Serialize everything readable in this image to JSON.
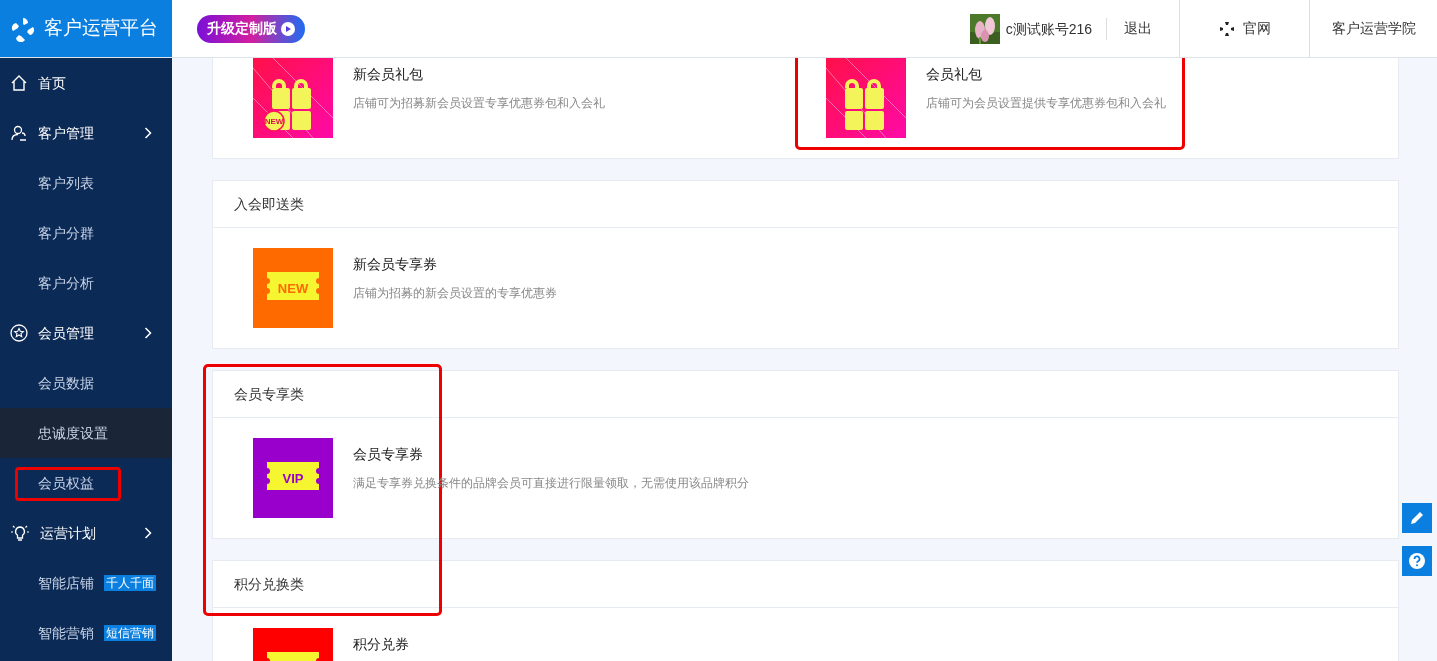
{
  "brand": {
    "title": "客户运营平台"
  },
  "header": {
    "upgrade": "升级定制版",
    "account": "c测试账号216",
    "logout": "退出",
    "website": "官网",
    "academy": "客户运营学院"
  },
  "sidebar": {
    "items": [
      {
        "label": "首页"
      },
      {
        "label": "客户管理",
        "children": [
          {
            "label": "客户列表",
            "selected": false,
            "highlighted": false
          },
          {
            "label": "客户分群",
            "selected": false,
            "highlighted": false
          },
          {
            "label": "客户分析",
            "selected": false,
            "highlighted": false
          }
        ]
      },
      {
        "label": "会员管理",
        "children": [
          {
            "label": "会员数据",
            "selected": false,
            "highlighted": false
          },
          {
            "label": "忠诚度设置",
            "selected": true,
            "highlighted": false
          },
          {
            "label": "会员权益",
            "selected": false,
            "highlighted": true
          }
        ]
      },
      {
        "label": "运营计划",
        "children": [
          {
            "label": "智能店铺",
            "badge": "千人千面",
            "selected": false,
            "highlighted": false
          },
          {
            "label": "智能营销",
            "badge": "短信营销",
            "selected": false,
            "highlighted": false
          }
        ]
      }
    ]
  },
  "sections": [
    {
      "highlighted": false,
      "items": [
        {
          "kind": "gift",
          "new_mark": "NEW",
          "title": "新会员礼包",
          "description": "店铺可为招募新会员设置专享优惠券包和入会礼",
          "highlighted": false
        },
        {
          "kind": "gift",
          "title": "会员礼包",
          "description": "店铺可为会员设置提供专享优惠券包和入会礼",
          "highlighted": true
        }
      ]
    },
    {
      "title": "入会即送类",
      "highlighted": false,
      "items": [
        {
          "kind": "ticket",
          "color": "#ff6a00",
          "ticket_text": "NEW",
          "title": "新会员专享券",
          "description": "店铺为招募的新会员设置的专享优惠券",
          "highlighted": false
        }
      ]
    },
    {
      "title": "会员专享类",
      "highlighted": true,
      "items": [
        {
          "kind": "ticket",
          "color": "#9900cc",
          "ticket_text": "VIP",
          "title": "会员专享券",
          "description": "满足专享券兑换条件的品牌会员可直接进行限量领取，无需使用该品牌积分",
          "highlighted": false
        }
      ]
    },
    {
      "title": "积分兑换类",
      "highlighted": false,
      "items": [
        {
          "kind": "ticket",
          "color": "#ff0000",
          "title": "积分兑券",
          "highlighted": false
        }
      ]
    }
  ]
}
